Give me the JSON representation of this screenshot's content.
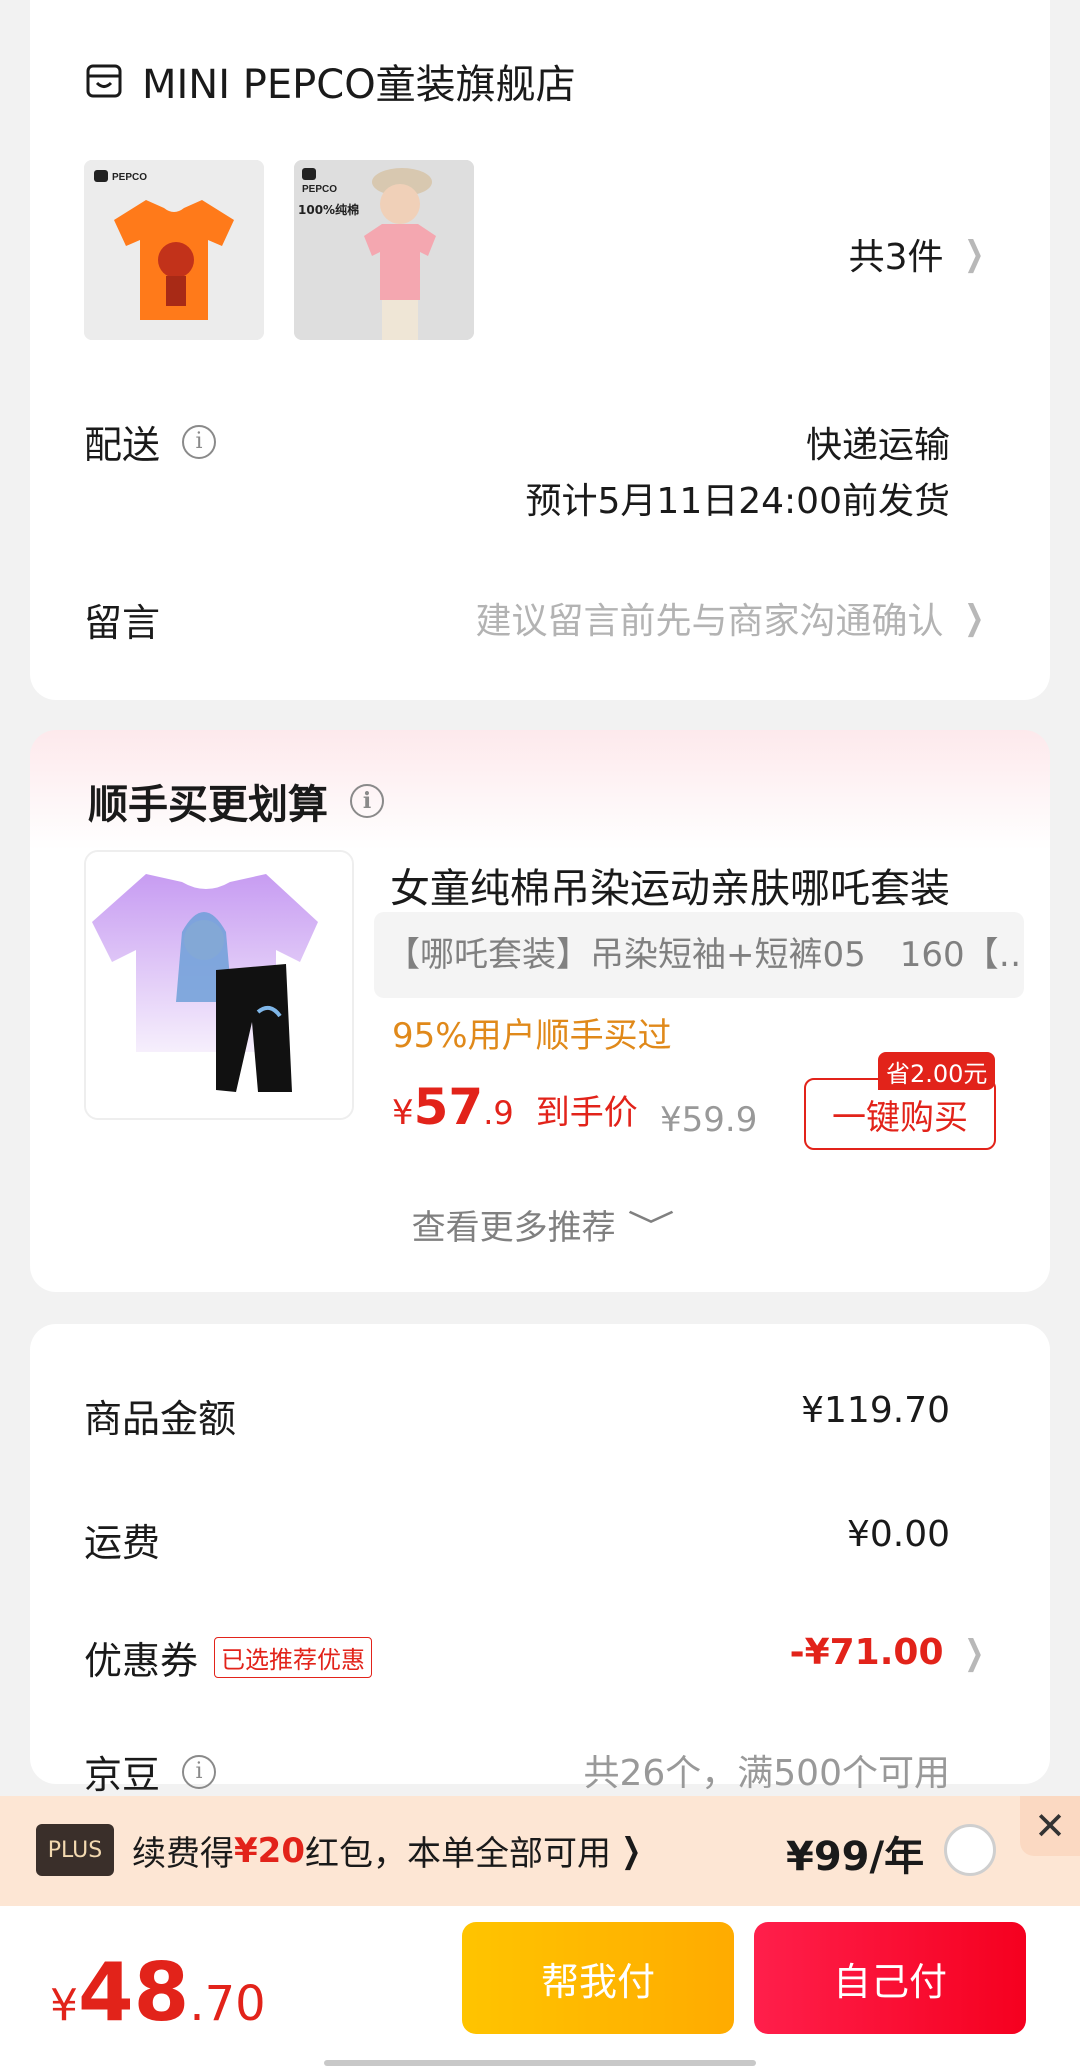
{
  "store": {
    "name": "MINI PEPCO童装旗舰店",
    "item_count": "共3件",
    "thumb1_brand": "PEPCO",
    "thumb2_brand": "PEPCO",
    "thumb2_badge": "100%纯棉"
  },
  "delivery": {
    "label": "配送",
    "method": "快递运输",
    "eta": "预计5月11日24:00前发货"
  },
  "message": {
    "label": "留言",
    "placeholder": "建议留言前先与商家沟通确认"
  },
  "recommend": {
    "title": "顺手买更划算",
    "product_name": "女童纯棉吊染运动亲肤哪吒套装",
    "spec": "【哪吒套装】吊染短袖+短裤05　160【…",
    "bought": "95%用户顺手买过",
    "price_currency": "¥",
    "price_int": "57",
    "price_dec": ".9",
    "price_tag": "到手价",
    "orig_price": "¥59.9",
    "save_badge": "省2.00元",
    "buy_label": "一键购买",
    "more_label": "查看更多推荐"
  },
  "summary": {
    "goods_label": "商品金额",
    "goods_value": "¥119.70",
    "shipping_label": "运费",
    "shipping_value": "¥0.00",
    "coupon_label": "优惠券",
    "coupon_tag": "已选推荐优惠",
    "coupon_value": "-¥71.00",
    "beans_label": "京豆",
    "beans_value": "共26个，满500个可用"
  },
  "plus": {
    "badge": "PLUS",
    "text_pre": "续费得",
    "text_amount": "¥20",
    "text_post": "红包，本单全部可用",
    "price": "¥99/年"
  },
  "checkout": {
    "currency": "¥",
    "total_int": "48",
    "total_dec": ".70",
    "help_pay": "帮我付",
    "self_pay": "自己付"
  },
  "colors": {
    "accent_red": "#e2231a",
    "accent_orange": "#e0891a",
    "help_yellow": "#ffb800"
  }
}
